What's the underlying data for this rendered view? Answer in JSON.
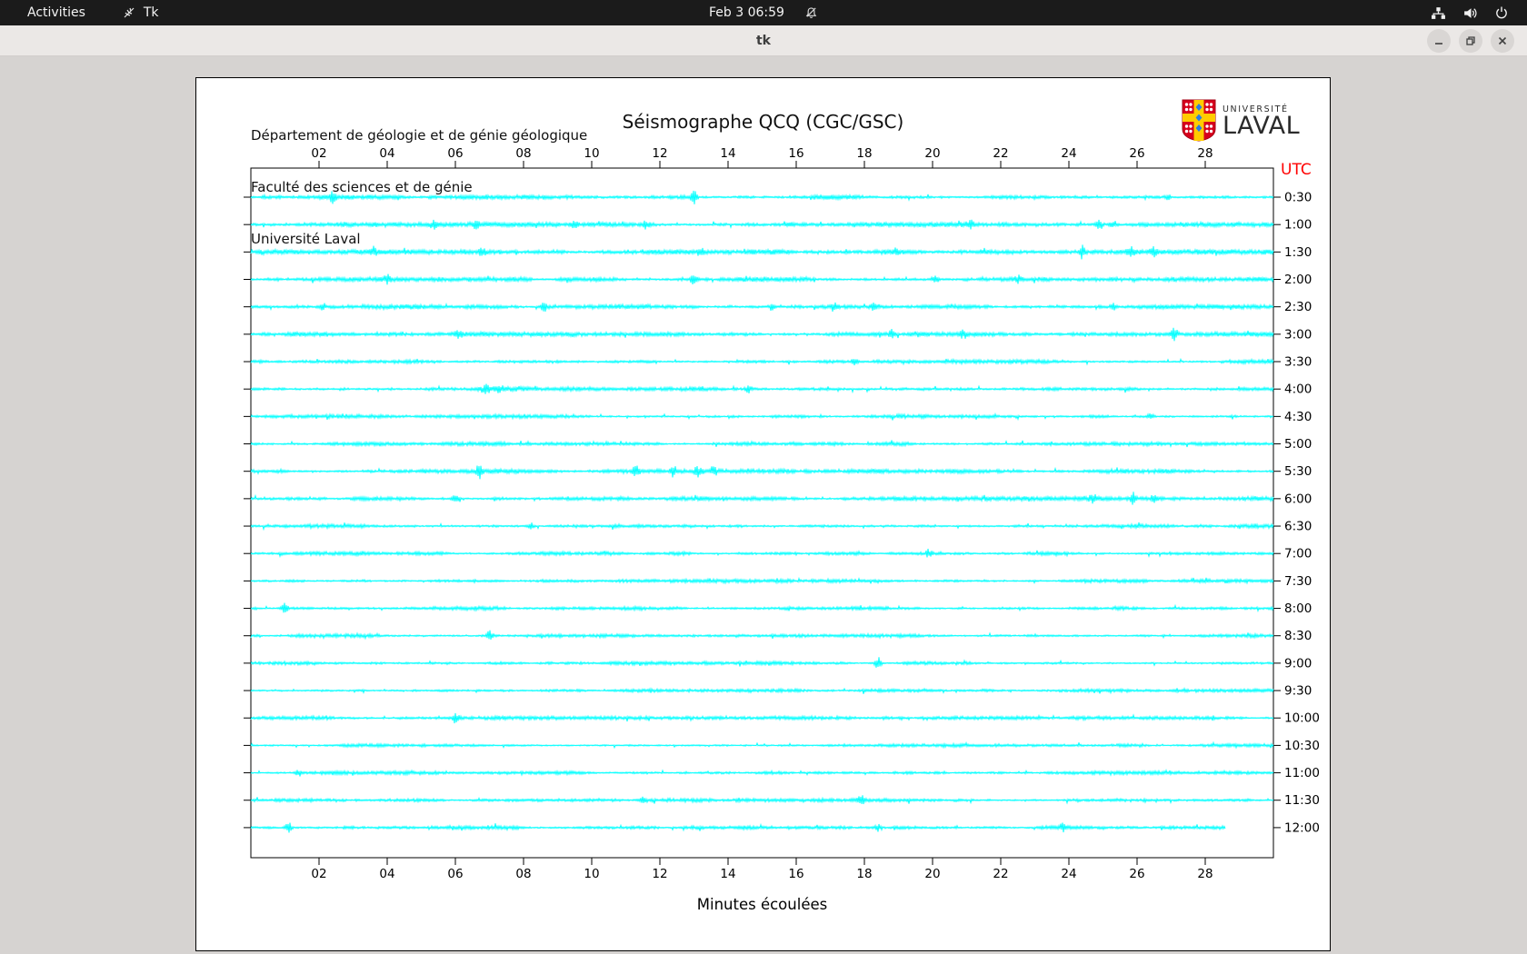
{
  "topbar": {
    "activities_label": "Activities",
    "app_name": "Tk",
    "clock": "Feb 3  06:59"
  },
  "titlebar": {
    "title": "tk"
  },
  "canvas": {
    "org_lines": [
      "Département de géologie et de génie géologique",
      "Faculté des sciences et de génie",
      "Université Laval"
    ],
    "title": "Séismographe QCQ (CGC/GSC)",
    "logo": {
      "line1": "UNIVERSITÉ",
      "line2": "LAVAL"
    }
  },
  "chart_data": {
    "type": "seismogram",
    "title": "Séismographe QCQ (CGC/GSC)",
    "xlabel": "Minutes écoulées",
    "utc_label": "UTC",
    "trace_color": "#00ffff",
    "axis_color": "#000000",
    "utc_label_color": "#ff0000",
    "x_ticks": [
      "02",
      "04",
      "06",
      "08",
      "10",
      "12",
      "14",
      "16",
      "18",
      "20",
      "22",
      "24",
      "26",
      "28"
    ],
    "x_range_minutes": [
      0,
      30
    ],
    "minutes_per_row": 30,
    "rows": [
      {
        "utc": "0:30",
        "noise": 1.0,
        "spikes": [
          [
            2.4,
            5
          ],
          [
            13.0,
            7
          ],
          [
            26.9,
            3
          ]
        ]
      },
      {
        "utc": "1:00",
        "noise": 1.0,
        "spikes": [
          [
            5.4,
            4
          ],
          [
            6.6,
            5
          ],
          [
            9.5,
            4
          ],
          [
            11.6,
            4
          ],
          [
            21.1,
            4
          ],
          [
            24.9,
            6
          ],
          [
            25.3,
            4
          ]
        ]
      },
      {
        "utc": "1:30",
        "noise": 1.05,
        "spikes": [
          [
            3.6,
            4
          ],
          [
            6.8,
            5
          ],
          [
            13.2,
            4
          ],
          [
            18.9,
            4
          ],
          [
            24.4,
            7
          ],
          [
            25.8,
            6
          ],
          [
            26.5,
            5
          ]
        ]
      },
      {
        "utc": "2:00",
        "noise": 0.95,
        "spikes": [
          [
            4.0,
            4
          ],
          [
            13.0,
            5
          ],
          [
            20.1,
            4
          ],
          [
            22.5,
            4
          ]
        ]
      },
      {
        "utc": "2:30",
        "noise": 1.0,
        "spikes": [
          [
            2.1,
            4
          ],
          [
            8.6,
            5
          ],
          [
            15.3,
            4
          ],
          [
            17.1,
            4
          ],
          [
            18.3,
            4
          ],
          [
            25.3,
            4
          ]
        ]
      },
      {
        "utc": "3:00",
        "noise": 0.95,
        "spikes": [
          [
            6.1,
            4
          ],
          [
            18.8,
            4
          ],
          [
            20.9,
            4
          ],
          [
            27.1,
            7
          ]
        ]
      },
      {
        "utc": "3:30",
        "noise": 0.85,
        "spikes": [
          [
            17.7,
            4
          ]
        ]
      },
      {
        "utc": "4:00",
        "noise": 0.95,
        "spikes": [
          [
            6.9,
            5
          ],
          [
            7.3,
            4
          ],
          [
            14.6,
            4
          ]
        ]
      },
      {
        "utc": "4:30",
        "noise": 0.85,
        "spikes": [
          [
            26.4,
            5
          ]
        ]
      },
      {
        "utc": "5:00",
        "noise": 0.8,
        "spikes": []
      },
      {
        "utc": "5:30",
        "noise": 0.9,
        "spikes": [
          [
            6.7,
            7
          ],
          [
            11.3,
            5
          ],
          [
            12.4,
            6
          ],
          [
            13.1,
            6
          ],
          [
            13.6,
            5
          ]
        ]
      },
      {
        "utc": "6:00",
        "noise": 0.9,
        "spikes": [
          [
            6.0,
            5
          ],
          [
            24.7,
            5
          ],
          [
            25.9,
            6
          ],
          [
            26.5,
            4
          ]
        ]
      },
      {
        "utc": "6:30",
        "noise": 0.85,
        "spikes": [
          [
            8.2,
            4
          ]
        ]
      },
      {
        "utc": "7:00",
        "noise": 0.8,
        "spikes": [
          [
            19.9,
            4
          ]
        ]
      },
      {
        "utc": "7:30",
        "noise": 0.75,
        "spikes": []
      },
      {
        "utc": "8:00",
        "noise": 0.8,
        "spikes": [
          [
            1.0,
            5
          ]
        ]
      },
      {
        "utc": "8:30",
        "noise": 0.75,
        "spikes": [
          [
            7.0,
            7
          ]
        ]
      },
      {
        "utc": "9:00",
        "noise": 0.75,
        "spikes": [
          [
            18.4,
            7
          ]
        ]
      },
      {
        "utc": "9:30",
        "noise": 0.7,
        "spikes": []
      },
      {
        "utc": "10:00",
        "noise": 0.75,
        "spikes": [
          [
            6.0,
            5
          ]
        ]
      },
      {
        "utc": "10:30",
        "noise": 0.7,
        "spikes": []
      },
      {
        "utc": "11:00",
        "noise": 0.75,
        "spikes": [
          [
            1.4,
            4
          ]
        ]
      },
      {
        "utc": "11:30",
        "noise": 0.75,
        "spikes": [
          [
            11.5,
            4
          ],
          [
            17.9,
            5
          ]
        ]
      },
      {
        "utc": "12:00",
        "noise": 0.8,
        "spikes": [
          [
            1.1,
            6
          ],
          [
            18.4,
            4
          ],
          [
            23.8,
            4
          ]
        ],
        "end_minute": 28.6
      }
    ]
  }
}
